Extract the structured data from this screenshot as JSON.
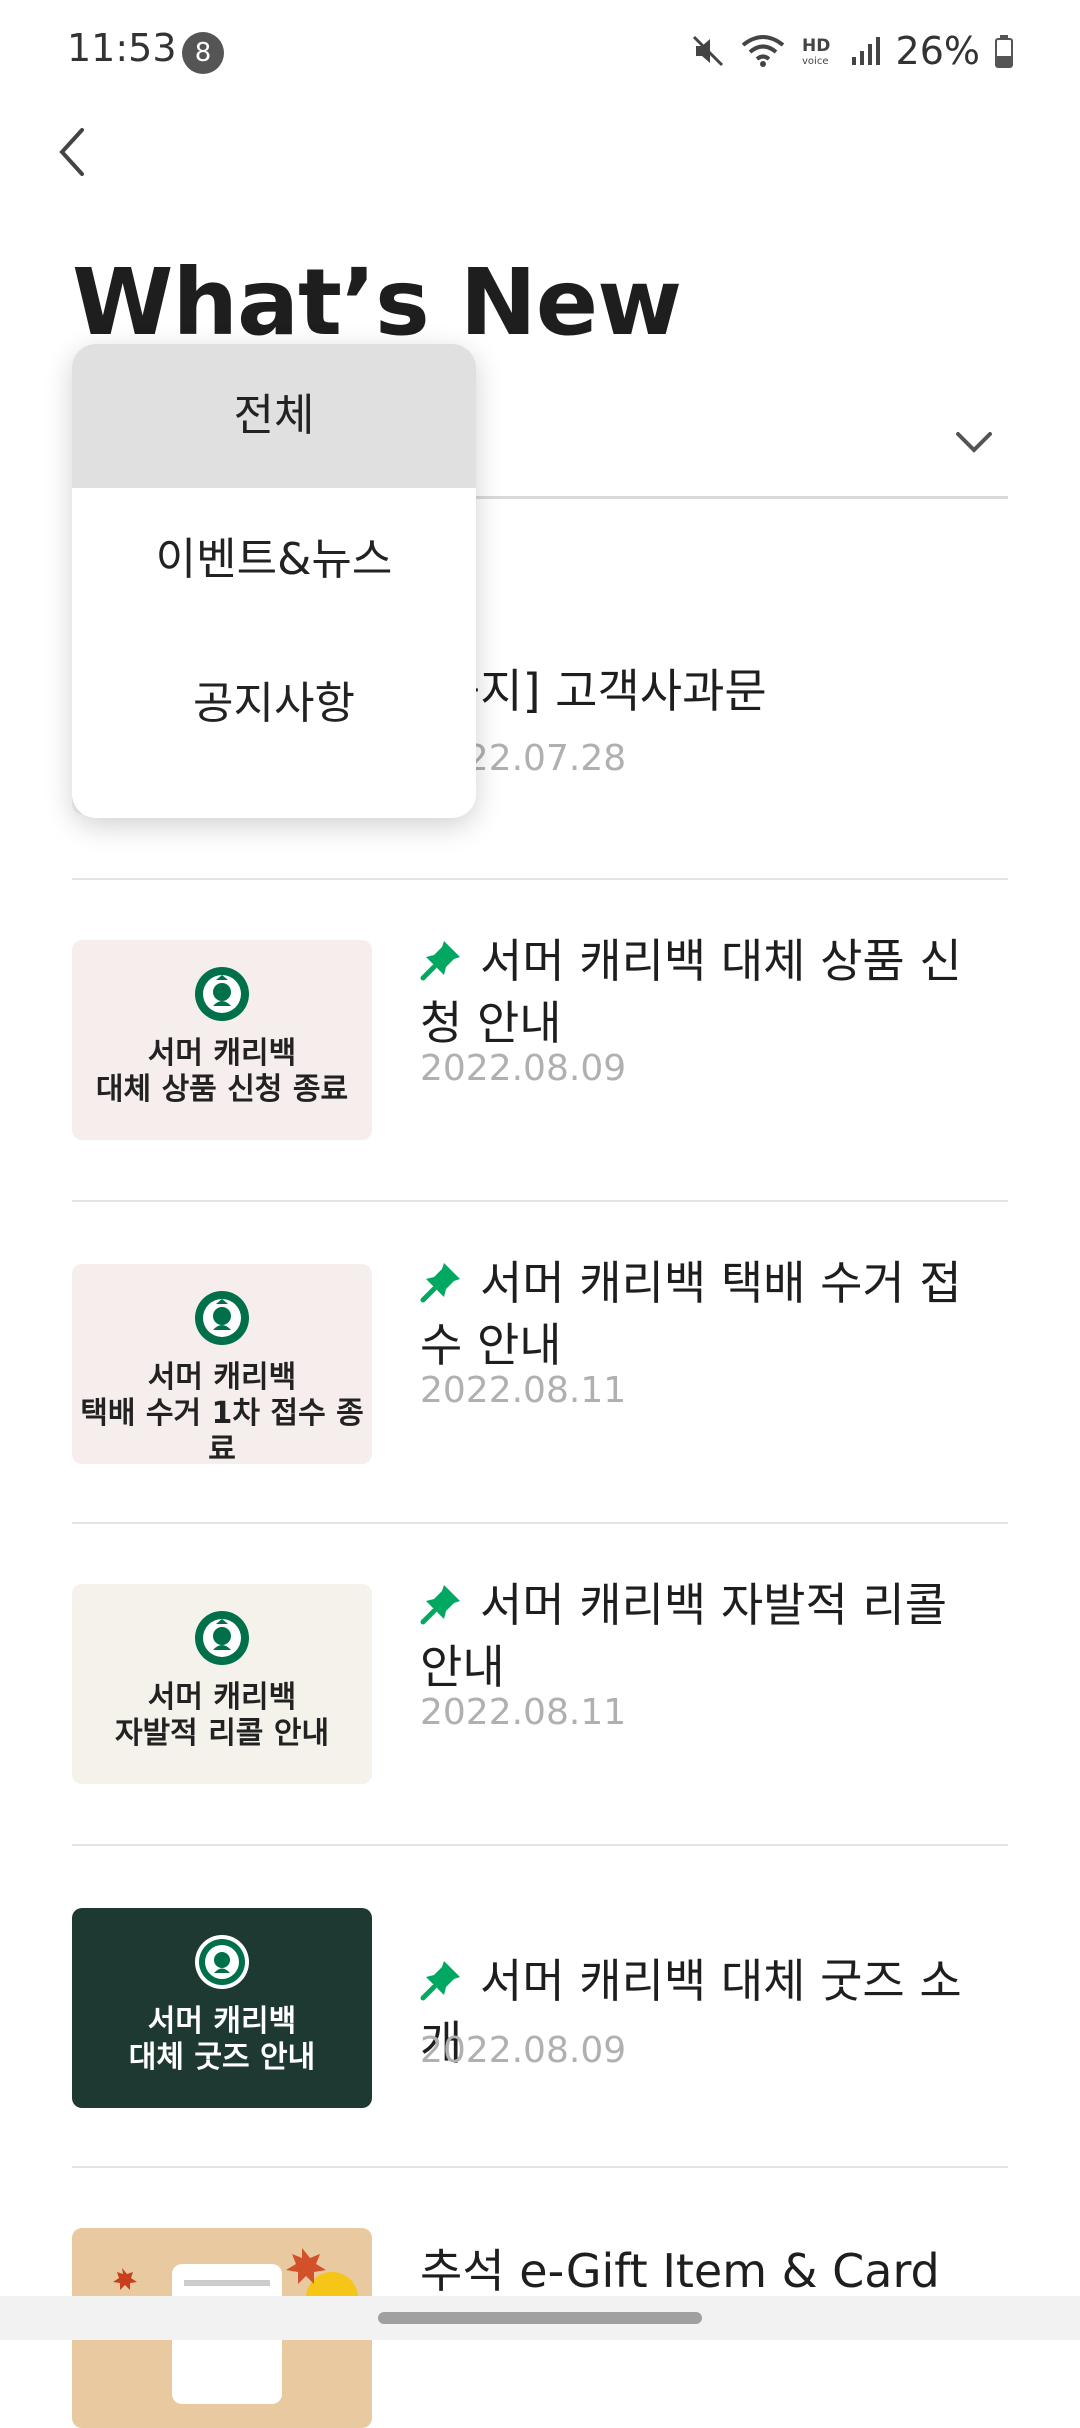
{
  "status": {
    "time": "11:53",
    "notif_count": "8",
    "battery": "26%"
  },
  "header": {
    "title": "What’s New"
  },
  "filter": {
    "selected": "전체",
    "options": [
      "전체",
      "이벤트&뉴스",
      "공지사항"
    ]
  },
  "items": [
    {
      "title": "[공지] 고객사과문",
      "date": "2022.07.28",
      "pinned": false
    },
    {
      "title": "서머 캐리백 대체 상품 신청 안내",
      "date": "2022.08.09",
      "pinned": true,
      "thumb_text": "서머 캐리백\n대체 상품 신청 종료",
      "thumb_bg": "#f5eeec",
      "thumb_fg": "#222222"
    },
    {
      "title": "서머 캐리백 택배 수거 접수 안내",
      "date": "2022.08.11",
      "pinned": true,
      "thumb_text": "서머 캐리백\n택배 수거 1차 접수 종료",
      "thumb_bg": "#f5eeec",
      "thumb_fg": "#222222"
    },
    {
      "title": "서머 캐리백 자발적 리콜 안내",
      "date": "2022.08.11",
      "pinned": true,
      "thumb_text": "서머 캐리백\n자발적 리콜 안내",
      "thumb_bg": "#f5f2ec",
      "thumb_fg": "#222222"
    },
    {
      "title": "서머 캐리백 대체 굿즈 소개",
      "date": "2022.08.09",
      "pinned": true,
      "thumb_text": "서머 캐리백\n대체 굿즈 안내",
      "thumb_bg": "#1e3932",
      "thumb_fg": "#ffffff"
    },
    {
      "title": "추석 e-Gift Item & Card",
      "date": "",
      "pinned": false,
      "thumb_text": "",
      "thumb_bg": "#e8c9a0",
      "thumb_fg": "#222222"
    }
  ],
  "colors": {
    "accent": "#00a862",
    "brand_dark": "#1e3932"
  }
}
